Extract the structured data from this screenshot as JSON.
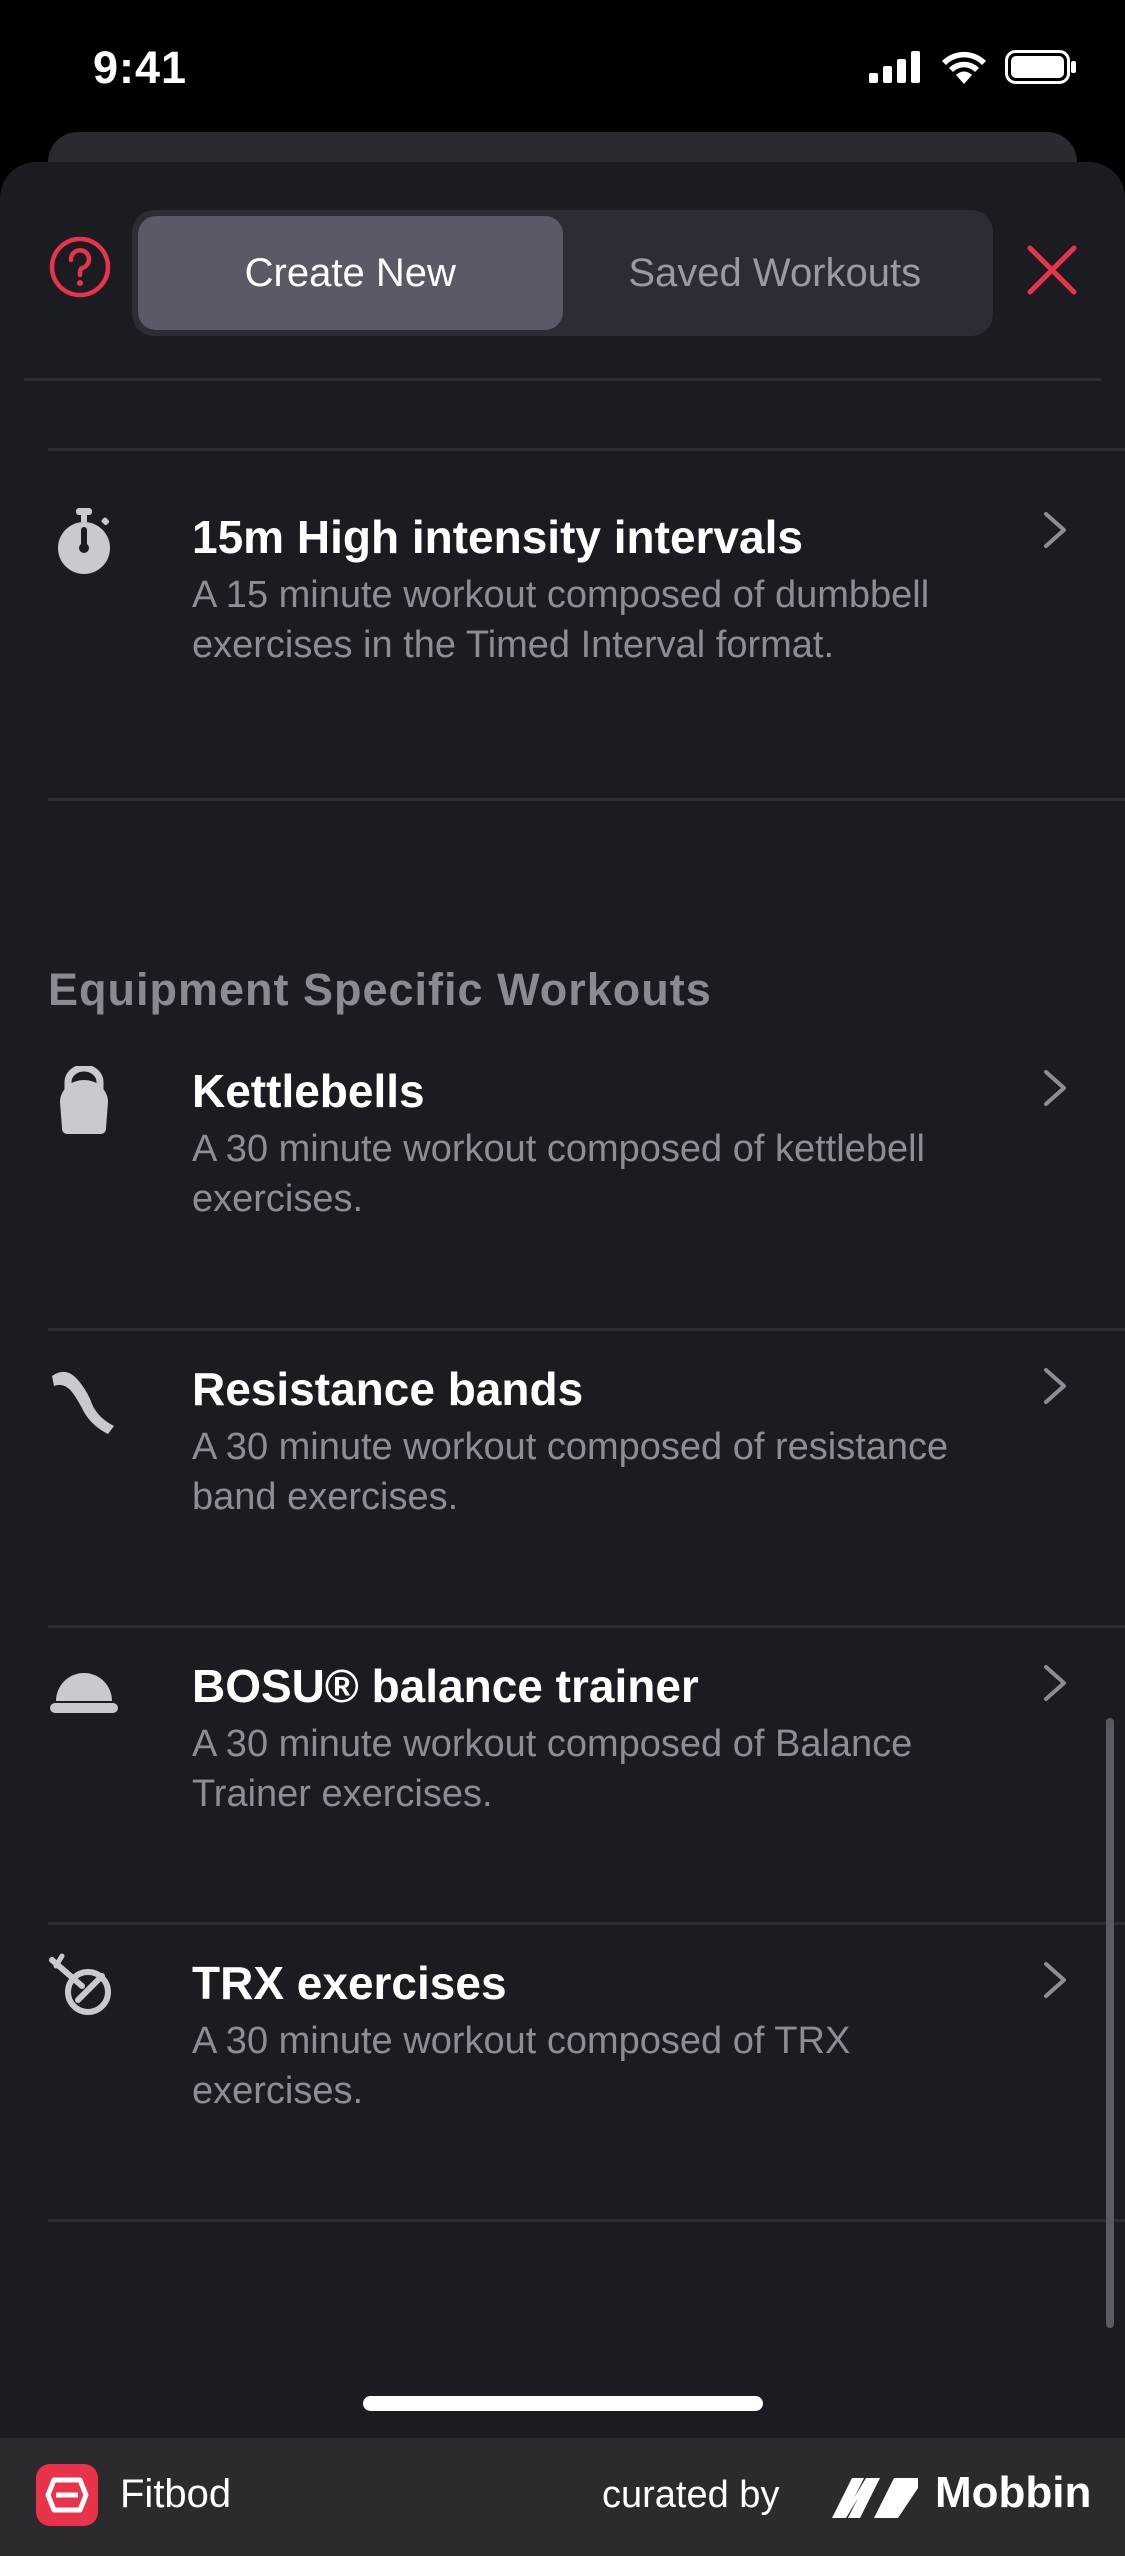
{
  "status_bar": {
    "time": "9:41"
  },
  "header": {
    "tabs": [
      {
        "label": "Create New",
        "active": true
      },
      {
        "label": "Saved Workouts",
        "active": false
      }
    ]
  },
  "rows": [
    {
      "title": "15m High intensity intervals",
      "desc": "A 15 minute workout composed of dumbbell exercises in the Timed Interval format.",
      "icon": "stopwatch-icon"
    }
  ],
  "section": {
    "title": "Equipment Specific Workouts"
  },
  "equipment_rows": [
    {
      "title": "Kettlebells",
      "desc": "A 30 minute workout composed of kettlebell exercises.",
      "icon": "kettlebell-icon"
    },
    {
      "title": "Resistance bands",
      "desc": "A 30 minute workout composed of resistance band exercises.",
      "icon": "resistance-band-icon"
    },
    {
      "title": "BOSU® balance trainer",
      "desc": "A 30 minute workout composed of Balance Trainer exercises.",
      "icon": "bosu-icon"
    },
    {
      "title": "TRX exercises",
      "desc": "A 30 minute workout composed of TRX exercises.",
      "icon": "trx-icon"
    }
  ],
  "brand_bar": {
    "app_name": "Fitbod",
    "curated_label": "curated by",
    "curator": "Mobbin"
  },
  "colors": {
    "accent": "#e8334a",
    "background": "#1b1b22",
    "muted_text": "#8d8d96"
  }
}
